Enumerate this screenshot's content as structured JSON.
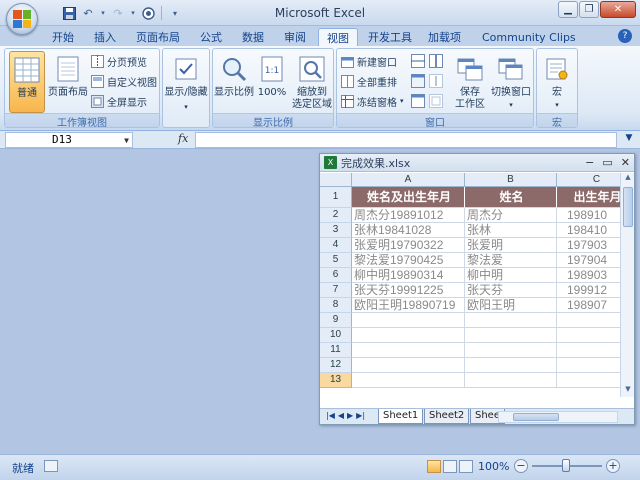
{
  "app": {
    "title": "Microsoft Excel"
  },
  "ribbon": {
    "tabs": [
      "开始",
      "插入",
      "页面布局",
      "公式",
      "数据",
      "审阅",
      "视图",
      "开发工具",
      "加载项",
      "Community Clips"
    ],
    "active_tab": "视图",
    "groups": {
      "workbook_views": {
        "label": "工作簿视图",
        "normal": "普通",
        "page_layout": "页面布局",
        "page_break": "分页预览",
        "custom_views": "自定义视图",
        "full_screen": "全屏显示"
      },
      "show_hide": {
        "label": "显示/隐藏"
      },
      "zoom": {
        "label": "显示比例",
        "zoom": "显示比例",
        "hundred": "100%",
        "zoom_selection_line1": "缩放到",
        "zoom_selection_line2": "选定区域"
      },
      "window": {
        "label": "窗口",
        "new_window": "新建窗口",
        "arrange_all": "全部重排",
        "freeze_panes": "冻结窗格",
        "save_workspace_line1": "保存",
        "save_workspace_line2": "工作区",
        "switch_windows": "切换窗口"
      },
      "macros": {
        "label": "宏",
        "macros": "宏"
      }
    }
  },
  "formula_bar": {
    "name_box": "D13",
    "fx": "fx",
    "formula": ""
  },
  "workbook": {
    "title": "完成效果.xlsx",
    "columns": [
      "A",
      "B",
      "C"
    ],
    "row_numbers": [
      "1",
      "2",
      "3",
      "4",
      "5",
      "6",
      "7",
      "8",
      "9",
      "10",
      "11",
      "12",
      "13"
    ],
    "header_row": [
      "姓名及出生年月",
      "姓名",
      "出生年月"
    ],
    "rows": [
      [
        "周杰分19891012",
        "周杰分",
        "198910"
      ],
      [
        "张林19841028",
        "张林",
        "198410"
      ],
      [
        "张爱明19790322",
        "张爱明",
        "197903"
      ],
      [
        "黎法爱19790425",
        "黎法爱",
        "197904"
      ],
      [
        "柳中明19890314",
        "柳中明",
        "198903"
      ],
      [
        "张天芬19991225",
        "张天芬",
        "199912"
      ],
      [
        "欧阳王明19890719",
        "欧阳王明",
        "198907"
      ]
    ],
    "sheets": [
      "Sheet1",
      "Sheet2",
      "Shee"
    ],
    "active_sheet": "Sheet1"
  },
  "status": {
    "ready": "就绪",
    "zoom": "100%"
  },
  "colors": {
    "header_fill": "#8c6a6a",
    "active_tab_bg": "#f2f7fd",
    "workspace_bg": "#b2c6e4"
  }
}
